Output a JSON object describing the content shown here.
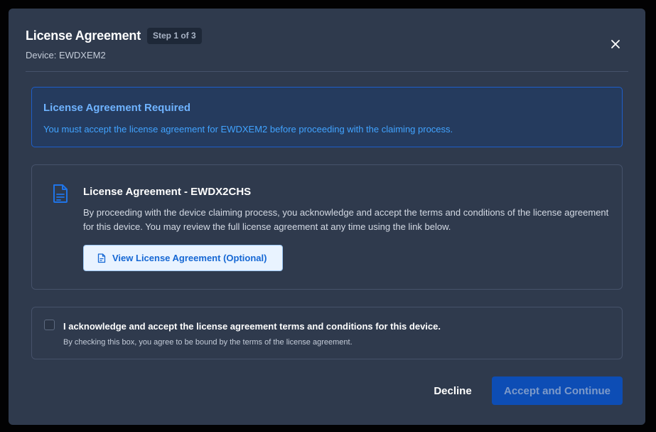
{
  "modal": {
    "title": "License Agreement",
    "step": "Step 1 of 3",
    "device_line": "Device: EWDXEM2"
  },
  "alert": {
    "title": "License Agreement Required",
    "message": "You must accept the license agreement for EWDXEM2 before proceeding with the claiming process."
  },
  "license_card": {
    "title": "License Agreement - EWDX2CHS",
    "body": "By proceeding with the device claiming process, you acknowledge and accept the terms and conditions of the license agreement for this device. You may review the full license agreement at any time using the link below.",
    "view_button": "View License Agreement (Optional)"
  },
  "acknowledge": {
    "label": "I acknowledge and accept the license agreement terms and conditions for this device.",
    "sub": "By checking this box, you agree to be bound by the terms of the license agreement.",
    "checked": false
  },
  "footer": {
    "decline": "Decline",
    "accept": "Accept and Continue"
  },
  "icons": {
    "close": "close-icon",
    "document": "document-icon"
  },
  "colors": {
    "modal_bg": "#2f3a4d",
    "alert_bg": "#253b5e",
    "alert_border": "#1e5ec9",
    "accent": "#0d4db5",
    "link": "#1567d4"
  }
}
